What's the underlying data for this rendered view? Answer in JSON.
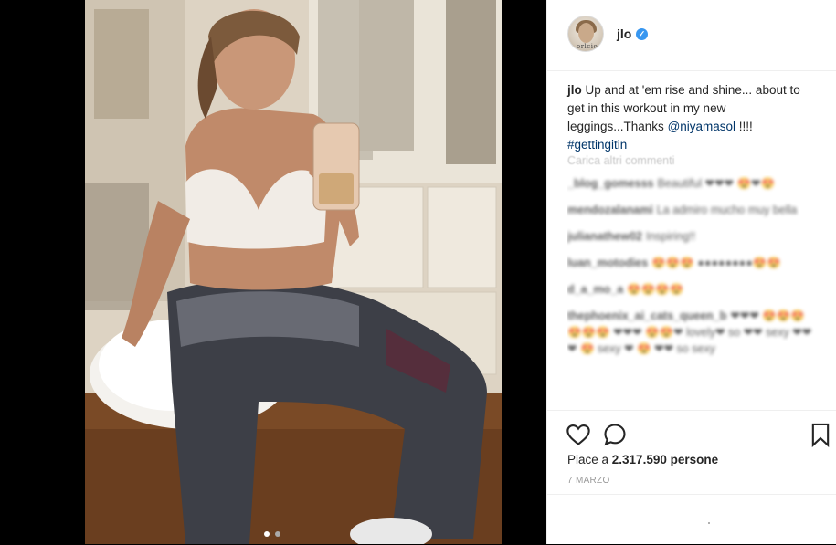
{
  "post": {
    "username": "jlo",
    "avatar_text": "orlcio",
    "caption_username": "jlo",
    "caption_text": " Up and at 'em rise and shine... about to get in this workout in my new leggings...Thanks ",
    "caption_mention": "@niyamasol",
    "caption_suffix": " !!!!",
    "caption_hashtag": "#gettingitin",
    "load_more": "Carica altri commenti",
    "comments": [
      {
        "user": "_blog_gomesss",
        "text": "Beautiful ❤❤❤ 😍❤😍"
      },
      {
        "user": "mendozalanami",
        "text": "La admiro mucho muy bella"
      },
      {
        "user": "julianathew02",
        "text": "Inspiring!!"
      },
      {
        "user": "luan_motodies",
        "text": "😍😍😍 ●●●●●●●●😍😍"
      },
      {
        "user": "d_a_mo_a",
        "text": "😍😍😍😍"
      },
      {
        "user": "thephoenix_ai_cats_queen_b",
        "text": "❤❤❤ 😍😍😍😍😍😍 ❤❤❤ 😍😍❤ lovely❤ so ❤❤ sexy ❤❤❤ 😍 sexy ❤ 😍 ❤❤ so sexy"
      }
    ],
    "likes_prefix": "Piace a ",
    "likes_count": "2.317.590",
    "likes_suffix": " persone",
    "date": "7 MARZO",
    "comment_placeholder": ""
  },
  "icons": {
    "like": "heart-icon",
    "comment": "comment-icon",
    "save": "bookmark-icon",
    "verified": "verified-check-icon"
  },
  "colors": {
    "link": "#003569",
    "verified": "#3897f0",
    "text": "#262626",
    "muted": "#999999"
  }
}
